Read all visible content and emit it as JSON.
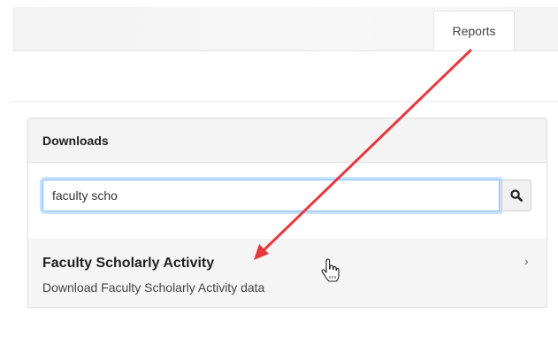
{
  "tabs": {
    "reports_label": "Reports"
  },
  "downloads": {
    "title": "Downloads",
    "search": {
      "value": "faculty scho",
      "placeholder": ""
    },
    "results": [
      {
        "title": "Faculty Scholarly Activity",
        "description": "Download Faculty Scholarly Activity data"
      }
    ]
  },
  "icons": {
    "search_button": "search-icon",
    "result_chevron": "chevron-right-icon",
    "cursor": "hand-pointer-icon",
    "annotation": "red-arrow"
  },
  "colors": {
    "annotation_arrow": "#e8383d",
    "input_focus": "#80bdff"
  }
}
